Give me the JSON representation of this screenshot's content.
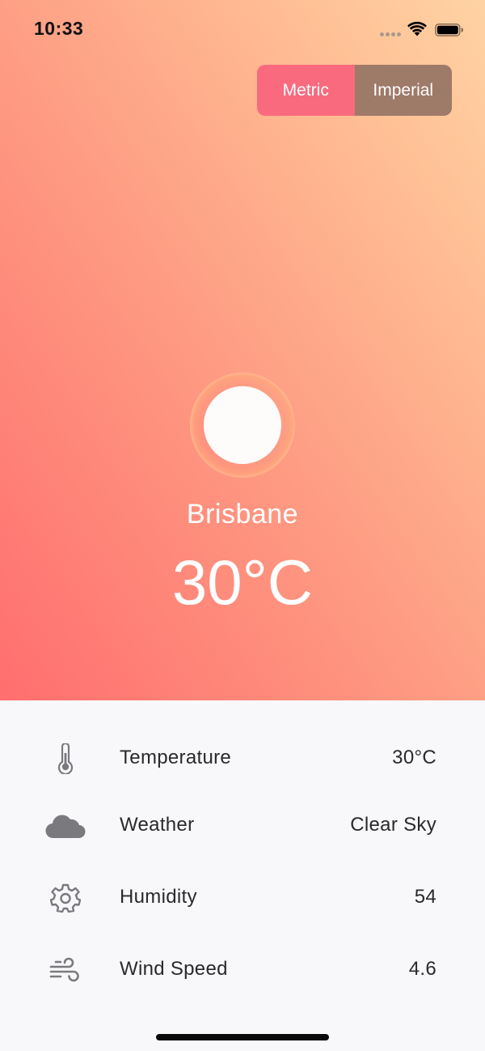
{
  "status_bar": {
    "time": "10:33",
    "icons": [
      "signal-dots-icon",
      "wifi-icon",
      "battery-icon"
    ]
  },
  "unit_toggle": {
    "options": [
      {
        "label": "Metric",
        "selected": true,
        "color": "#f96a7e"
      },
      {
        "label": "Imperial",
        "selected": false,
        "color": "#9e7a69"
      }
    ]
  },
  "current": {
    "icon": "sun-icon",
    "city": "Brisbane",
    "temperature": "30°C"
  },
  "details": [
    {
      "icon": "thermometer-icon",
      "label": "Temperature",
      "value": "30°C"
    },
    {
      "icon": "cloud-icon",
      "label": "Weather",
      "value": "Clear Sky"
    },
    {
      "icon": "gear-icon",
      "label": "Humidity",
      "value": "54"
    },
    {
      "icon": "wind-icon",
      "label": "Wind Speed",
      "value": "4.6"
    }
  ],
  "theme": {
    "gradient_start": "#ff6e6e",
    "gradient_end": "#ffd3a3",
    "panel_background": "#f8f7fa",
    "icon_color": "#7a7a7e"
  }
}
